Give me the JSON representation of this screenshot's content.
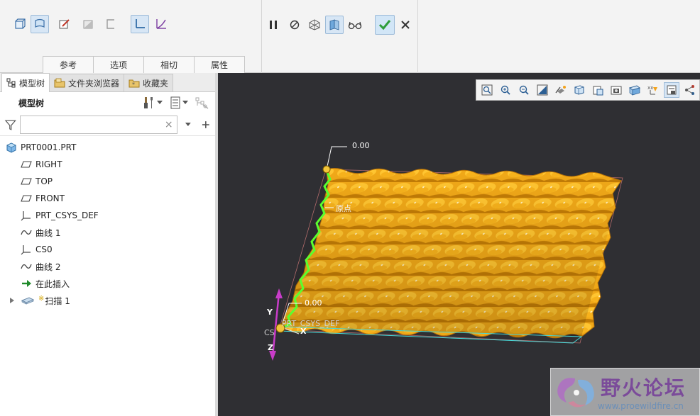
{
  "ribbon": {
    "tabs": [
      "参考",
      "选项",
      "相切",
      "属性"
    ]
  },
  "panel": {
    "tabs": [
      {
        "label": "模型树",
        "icon": "model-tree-icon"
      },
      {
        "label": "文件夹浏览器",
        "icon": "folder-browser-icon"
      },
      {
        "label": "收藏夹",
        "icon": "favorites-icon"
      }
    ],
    "tree_title": "模型树",
    "search_value": "",
    "search_placeholder": "",
    "clear_glyph": "×",
    "tree_items": [
      {
        "label": "PRT0001.PRT",
        "icon": "part-icon",
        "level": 0
      },
      {
        "label": "RIGHT",
        "icon": "datum-plane-icon",
        "level": 1
      },
      {
        "label": "TOP",
        "icon": "datum-plane-icon",
        "level": 1
      },
      {
        "label": "FRONT",
        "icon": "datum-plane-icon",
        "level": 1
      },
      {
        "label": "PRT_CSYS_DEF",
        "icon": "csys-icon",
        "level": 1
      },
      {
        "label": "曲线 1",
        "icon": "curve-icon",
        "level": 1
      },
      {
        "label": "CS0",
        "icon": "csys-icon",
        "level": 1
      },
      {
        "label": "曲线 2",
        "icon": "curve-icon",
        "level": 1
      },
      {
        "label": "在此插入",
        "icon": "insert-here-icon",
        "level": 1
      },
      {
        "label": "扫描 1",
        "icon": "sweep-icon",
        "level": 1,
        "expandable": true
      }
    ]
  },
  "viewport": {
    "dim_top": "0.00",
    "dim_bottom": "0.00",
    "origin_label": "原点",
    "csys_label": "PRT_CSYS_DEF",
    "cs_label": "CS",
    "axis_y": "Y",
    "axis_z": "Z",
    "axis_x": "X"
  },
  "watermark": {
    "title": "野火论坛",
    "url": "www.proewildfire.cn"
  },
  "colors": {
    "surface": "#f0a818",
    "surface_dark": "#c27c06",
    "edge_highlight": "#5aff2e",
    "axis": "#c83cc8",
    "viewport_bg": "#2f2f33",
    "confirm_check": "#2e9e3a"
  }
}
